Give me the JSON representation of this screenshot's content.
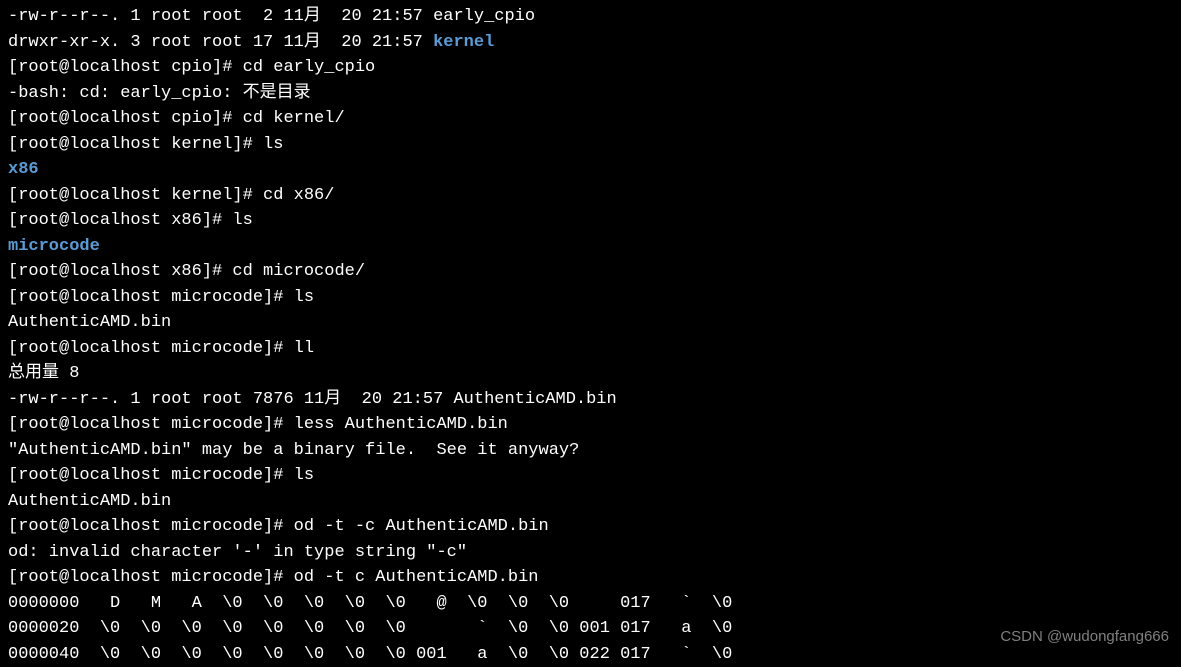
{
  "lines": [
    {
      "segments": [
        {
          "text": "-rw-r--r--. 1 root root  2 11月  20 21:57 early_cpio",
          "cls": ""
        }
      ]
    },
    {
      "segments": [
        {
          "text": "drwxr-xr-x. 3 root root 17 11月  20 21:57 ",
          "cls": ""
        },
        {
          "text": "kernel",
          "cls": "dir"
        }
      ]
    },
    {
      "segments": [
        {
          "text": "[root@localhost cpio]# cd early_cpio",
          "cls": ""
        }
      ]
    },
    {
      "segments": [
        {
          "text": "-bash: cd: early_cpio: 不是目录",
          "cls": ""
        }
      ]
    },
    {
      "segments": [
        {
          "text": "[root@localhost cpio]# cd kernel/",
          "cls": ""
        }
      ]
    },
    {
      "segments": [
        {
          "text": "[root@localhost kernel]# ls",
          "cls": ""
        }
      ]
    },
    {
      "segments": [
        {
          "text": "x86",
          "cls": "dir"
        }
      ]
    },
    {
      "segments": [
        {
          "text": "[root@localhost kernel]# cd x86/",
          "cls": ""
        }
      ]
    },
    {
      "segments": [
        {
          "text": "[root@localhost x86]# ls",
          "cls": ""
        }
      ]
    },
    {
      "segments": [
        {
          "text": "microcode",
          "cls": "dir"
        }
      ]
    },
    {
      "segments": [
        {
          "text": "[root@localhost x86]# cd microcode/",
          "cls": ""
        }
      ]
    },
    {
      "segments": [
        {
          "text": "[root@localhost microcode]# ls",
          "cls": ""
        }
      ]
    },
    {
      "segments": [
        {
          "text": "AuthenticAMD.bin",
          "cls": ""
        }
      ]
    },
    {
      "segments": [
        {
          "text": "[root@localhost microcode]# ll",
          "cls": ""
        }
      ]
    },
    {
      "segments": [
        {
          "text": "总用量 8",
          "cls": ""
        }
      ]
    },
    {
      "segments": [
        {
          "text": "-rw-r--r--. 1 root root 7876 11月  20 21:57 AuthenticAMD.bin",
          "cls": ""
        }
      ]
    },
    {
      "segments": [
        {
          "text": "[root@localhost microcode]# less AuthenticAMD.bin",
          "cls": ""
        }
      ]
    },
    {
      "segments": [
        {
          "text": "\"AuthenticAMD.bin\" may be a binary file.  See it anyway?",
          "cls": ""
        }
      ]
    },
    {
      "segments": [
        {
          "text": "[root@localhost microcode]# ls",
          "cls": ""
        }
      ]
    },
    {
      "segments": [
        {
          "text": "AuthenticAMD.bin",
          "cls": ""
        }
      ]
    },
    {
      "segments": [
        {
          "text": "[root@localhost microcode]# od -t -c AuthenticAMD.bin",
          "cls": ""
        }
      ]
    },
    {
      "segments": [
        {
          "text": "od: invalid character '-' in type string \"-c\"",
          "cls": ""
        }
      ]
    },
    {
      "segments": [
        {
          "text": "[root@localhost microcode]# od -t c AuthenticAMD.bin",
          "cls": ""
        }
      ]
    },
    {
      "segments": [
        {
          "text": "0000000   D   M   A  \\0  \\0  \\0  \\0  \\0   @  \\0  \\0  \\0     017   `  \\0",
          "cls": ""
        }
      ]
    },
    {
      "segments": [
        {
          "text": "0000020  \\0  \\0  \\0  \\0  \\0  \\0  \\0  \\0       `  \\0  \\0 001 017   a  \\0",
          "cls": ""
        }
      ]
    },
    {
      "segments": [
        {
          "text": "0000040  \\0  \\0  \\0  \\0  \\0  \\0  \\0  \\0 001   a  \\0  \\0 022 017   `  \\0",
          "cls": ""
        }
      ]
    }
  ],
  "watermark": "CSDN @wudongfang666"
}
